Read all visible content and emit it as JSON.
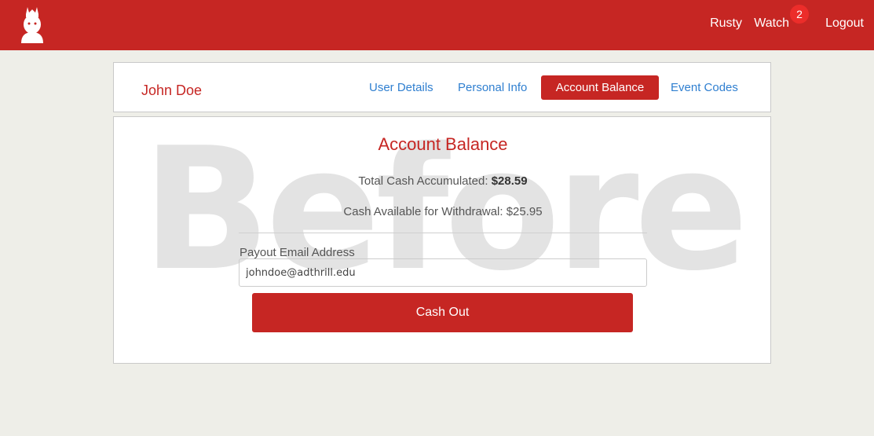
{
  "header": {
    "logo_icon": "chef-avatar-icon",
    "nav": {
      "rusty": "Rusty",
      "watch": "Watch",
      "watch_badge": "2",
      "logout": "Logout"
    }
  },
  "profile": {
    "name": "John Doe",
    "tabs": [
      {
        "label": "User Details",
        "active": false
      },
      {
        "label": "Personal Info",
        "active": false
      },
      {
        "label": "Account Balance",
        "active": true
      },
      {
        "label": "Event Codes",
        "active": false
      }
    ]
  },
  "balance": {
    "watermark": "Before",
    "title": "Account Balance",
    "total_label": "Total Cash Accumulated:",
    "total_value": "$28.59",
    "available_label": "Cash Available for Withdrawal:",
    "available_value": "$25.95",
    "email_label": "Payout Email Address",
    "email_value": "johndoe@adthrill.edu",
    "cashout_label": "Cash Out"
  },
  "colors": {
    "brand_red": "#c62623",
    "link_blue": "#2f7fd0",
    "badge_red": "#ec2d2a"
  }
}
